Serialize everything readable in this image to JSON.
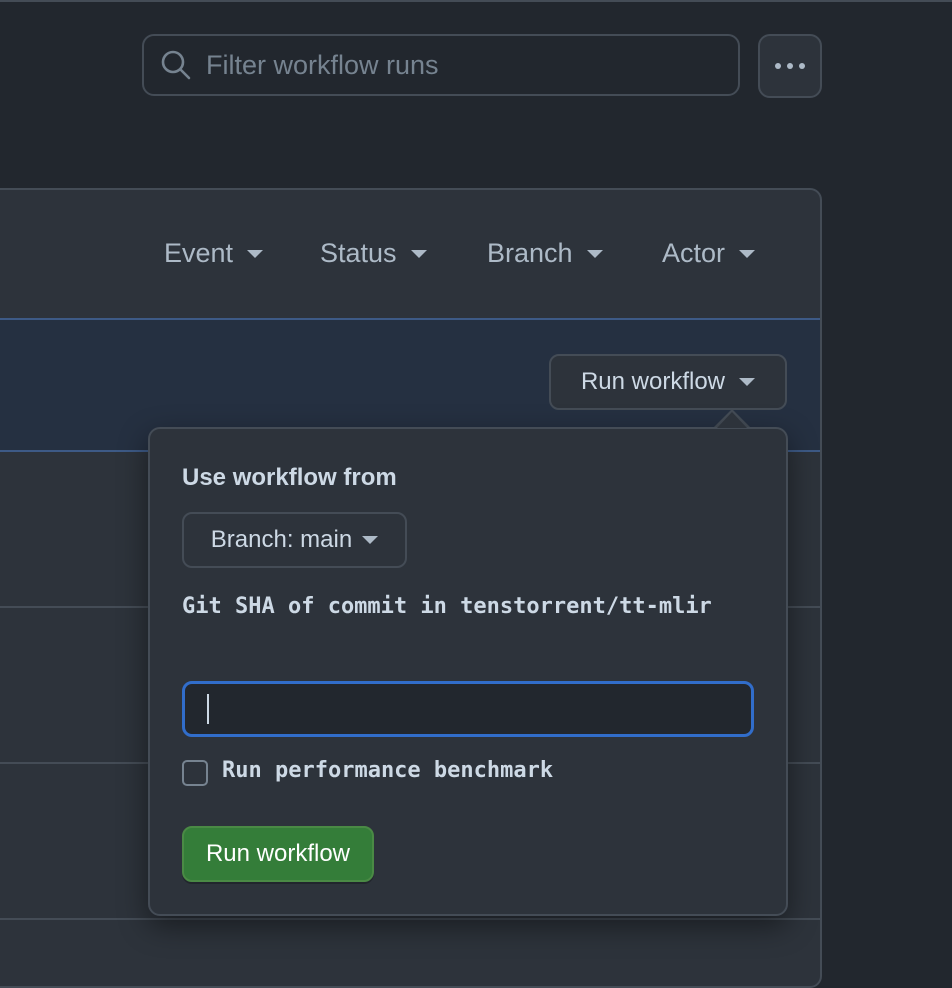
{
  "search": {
    "placeholder": "Filter workflow runs",
    "icon": "search-icon"
  },
  "more_button": {
    "icon": "kebab-horizontal-icon"
  },
  "filters": [
    {
      "label": "Event"
    },
    {
      "label": "Status"
    },
    {
      "label": "Branch"
    },
    {
      "label": "Actor"
    }
  ],
  "run_workflow_button": {
    "label": "Run workflow"
  },
  "popover": {
    "use_workflow_from_label": "Use workflow from",
    "branch_button_label": "Branch: main",
    "sha_label": "Git SHA of commit in tenstorrent/tt-mlir",
    "sha_value": "",
    "benchmark_label": "Run performance benchmark",
    "benchmark_checked": false,
    "submit_label": "Run workflow"
  },
  "colors": {
    "background": "#22272e",
    "panel": "#2d333b",
    "border": "#444c56",
    "accent_blue": "#316dca",
    "primary_green": "#347d39"
  }
}
